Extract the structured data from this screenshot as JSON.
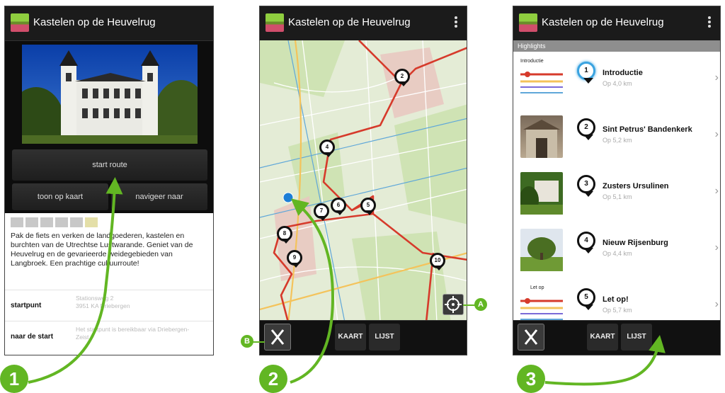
{
  "app": {
    "title": "Kastelen op de Heuvelrug"
  },
  "screen1": {
    "start_button": "start route",
    "show_map_button": "toon op kaart",
    "navigate_button": "navigeer naar",
    "description": "Pak de fiets en verken de landgoederen, kastelen en burchten van de Utrechtse Lustwarande. Geniet van de Heuvelrug en de gevarieerde weidegebieden van Langbroek. Een prachtige cultuurroute!",
    "info_rows": [
      {
        "label": "startpunt",
        "value": "Stationsweg 2\n3951 KA Driebergen"
      },
      {
        "label": "naar de start",
        "value": "Het startpunt is bereikbaar via Driebergen-Zeist."
      }
    ]
  },
  "screen2": {
    "tabs": {
      "map": "KAART",
      "list": "LIJST"
    },
    "markers": [
      "2",
      "4",
      "5",
      "6",
      "7",
      "8",
      "9",
      "10"
    ]
  },
  "screen3": {
    "section_header": "Highlights",
    "tabs": {
      "map": "KAART",
      "list": "LIJST"
    },
    "items": [
      {
        "number": "1",
        "title": "Introductie",
        "distance": "Op 4,0 km",
        "thumb_label": "Introductie"
      },
      {
        "number": "2",
        "title": "Sint Petrus' Bandenkerk",
        "distance": "Op 5,2 km"
      },
      {
        "number": "3",
        "title": "Zusters Ursulinen",
        "distance": "Op 5,1 km"
      },
      {
        "number": "4",
        "title": "Nieuw Rijsenburg",
        "distance": "Op 4,4 km"
      },
      {
        "number": "5",
        "title": "Let op!",
        "distance": "Op 5,7 km",
        "thumb_label": "Let op"
      }
    ]
  },
  "annotations": {
    "step1": "1",
    "step2": "2",
    "step3": "3",
    "callout_a": "A",
    "callout_b": "B"
  },
  "colors": {
    "accent_green": "#62b623",
    "route_red": "#d63a2b",
    "appbar": "#1b1b1b"
  }
}
